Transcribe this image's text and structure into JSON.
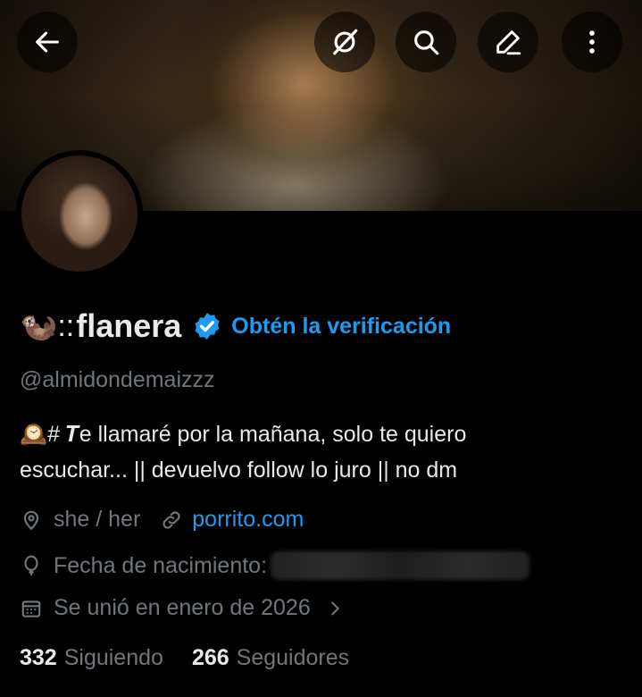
{
  "header": {
    "back_icon": "arrow-left-icon",
    "actions": [
      "grok-icon",
      "search-icon",
      "edit-icon",
      "more-vertical-icon"
    ]
  },
  "profile": {
    "name_prefix": "🦦::",
    "name": "flanera",
    "verified_badge_color": "#1d9bf0",
    "get_verified_label": "Obtén la verificación",
    "handle": "@almidondemaizzz",
    "bio_line1": "🕰️# 𝑻e llamaré por la mañana, solo te quiero",
    "bio_line2": "escuchar... || devuelvo follow lo juro || no dm",
    "pronouns": "she / her",
    "website": "porrito.com",
    "birthday_label": "Fecha de nacimiento:",
    "joined": "Se unió en enero de 2026",
    "following_count": "332",
    "following_label": "Siguiendo",
    "followers_count": "266",
    "followers_label": "Seguidores"
  },
  "colors": {
    "accent": "#1d9bf0",
    "muted": "#71767b",
    "text": "#e7e9ea",
    "background": "#000000"
  }
}
